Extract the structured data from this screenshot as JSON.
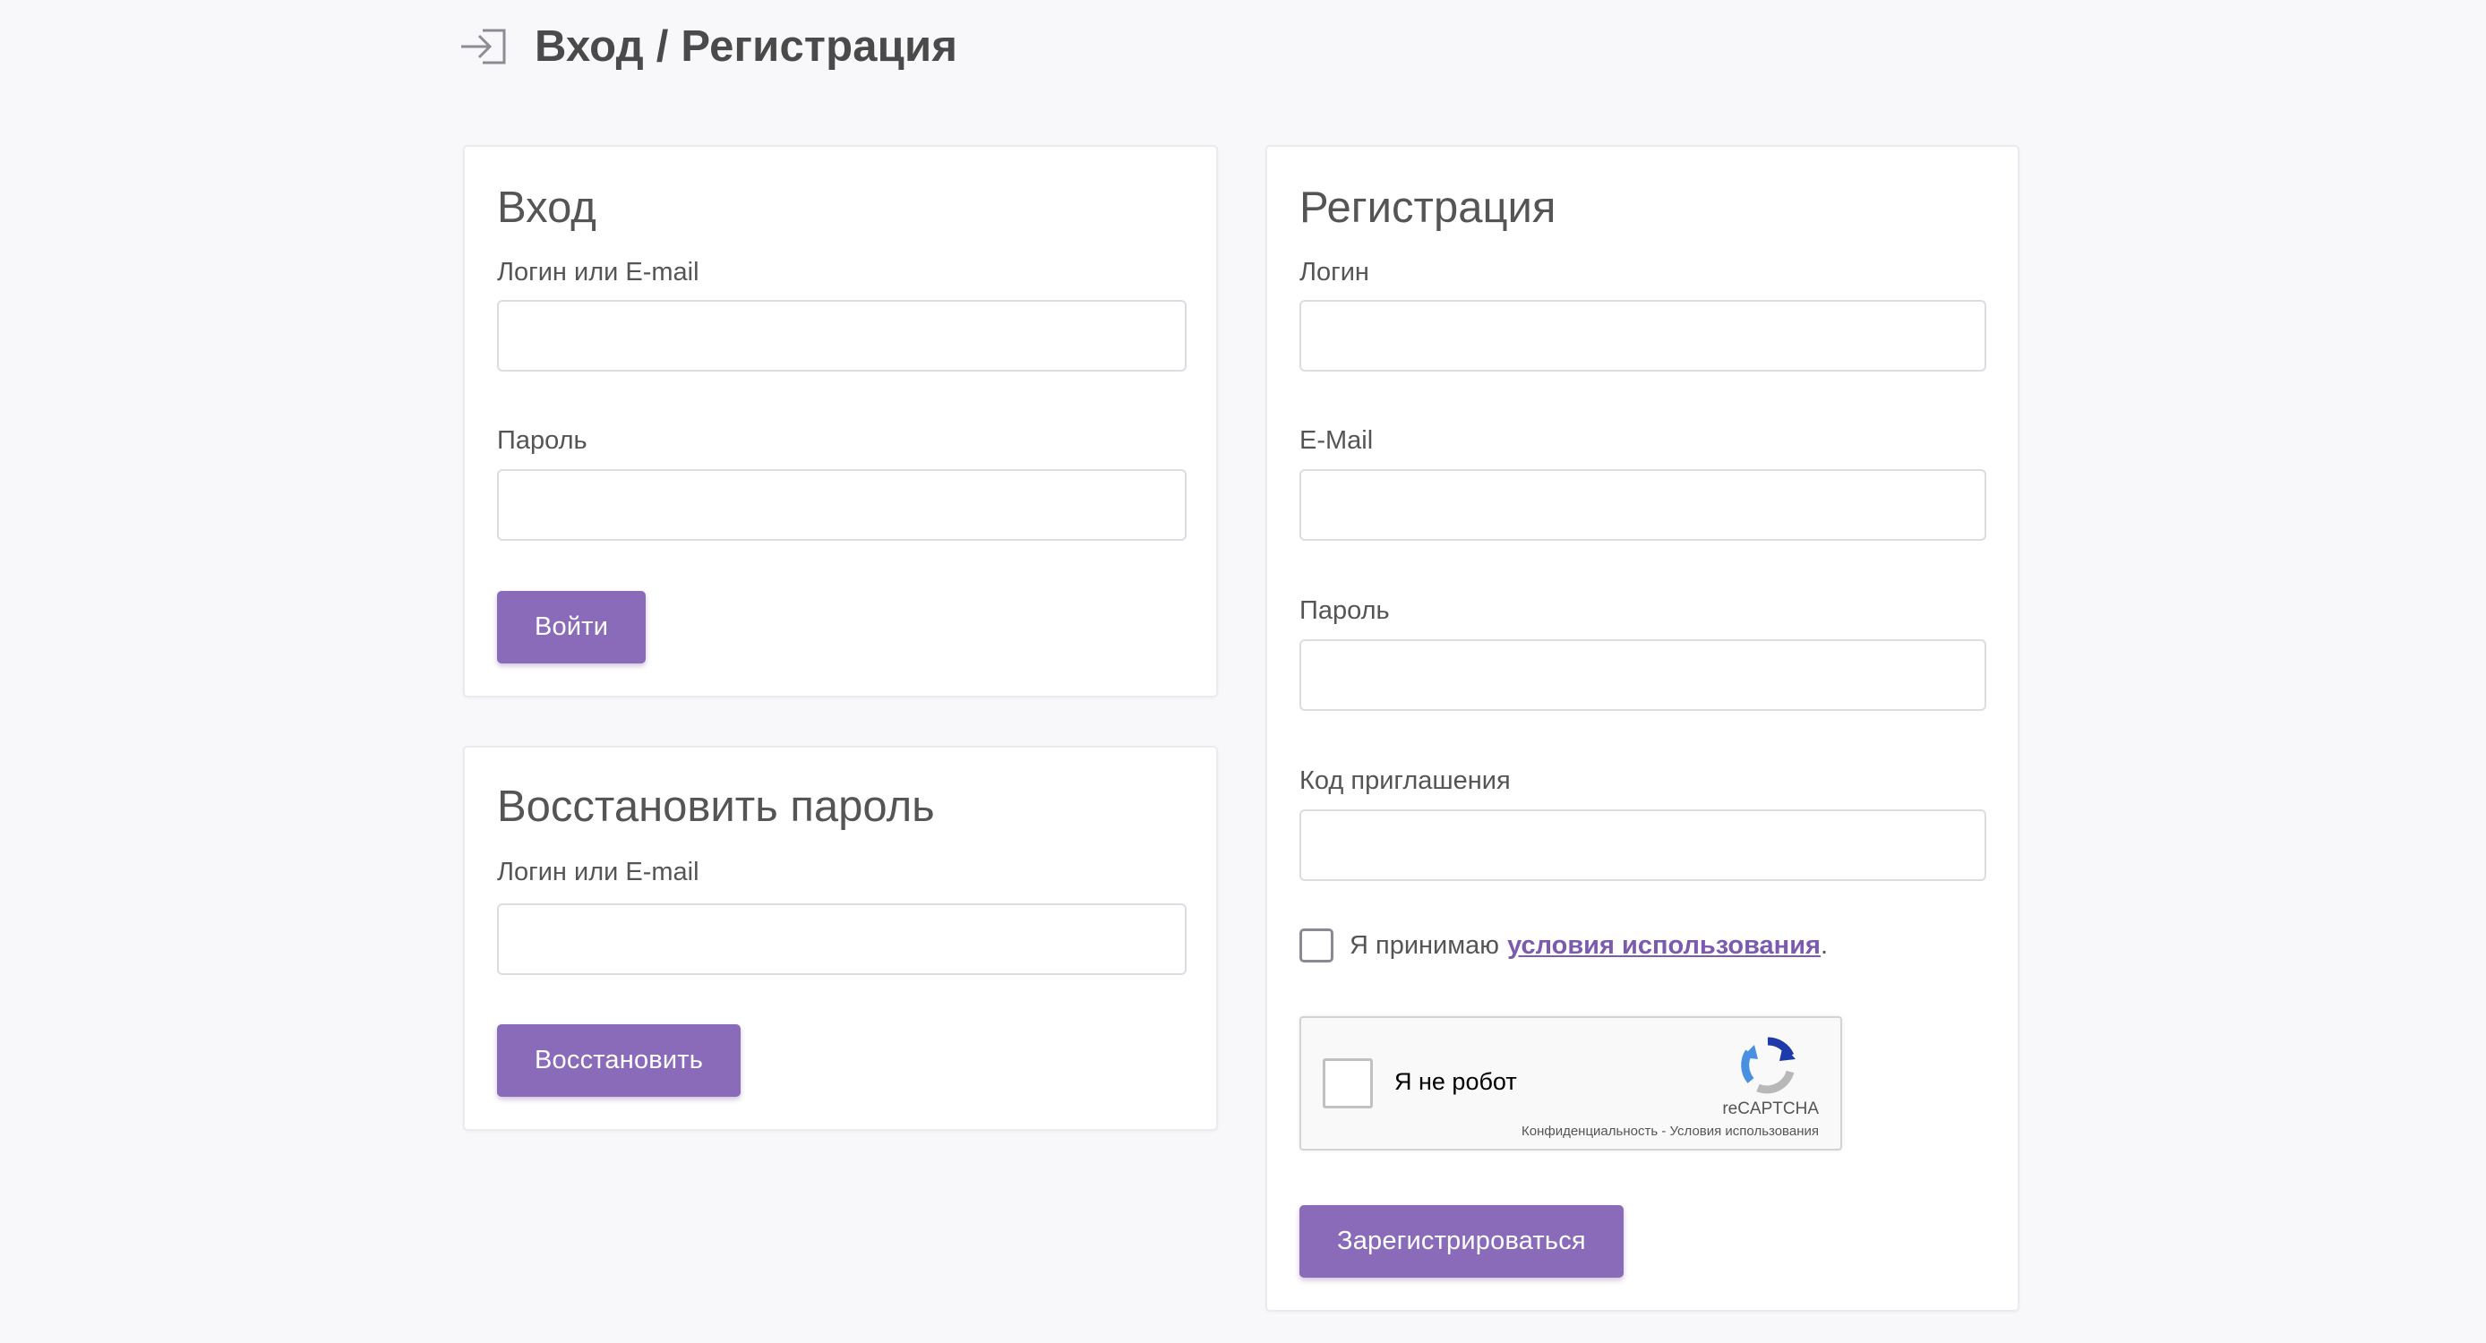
{
  "header": {
    "title": "Вход / Регистрация",
    "icon": "login-arrow-icon"
  },
  "colors": {
    "accent": "#8a6bba",
    "link": "#7b5aaf",
    "background": "#f8f8fa"
  },
  "login": {
    "title": "Вход",
    "username_label": "Логин или E-mail",
    "username_value": "",
    "password_label": "Пароль",
    "password_value": "",
    "submit_label": "Войти"
  },
  "recover": {
    "title": "Восстановить пароль",
    "username_label": "Логин или E-mail",
    "username_value": "",
    "submit_label": "Восстановить"
  },
  "register": {
    "title": "Регистрация",
    "login_label": "Логин",
    "login_value": "",
    "email_label": "E-Mail",
    "email_value": "",
    "password_label": "Пароль",
    "password_value": "",
    "invite_label": "Код приглашения",
    "invite_value": "",
    "terms_prefix": "Я принимаю",
    "terms_link": "условия использования",
    "terms_suffix": ".",
    "terms_checked": false,
    "submit_label": "Зарегистрироваться"
  },
  "recaptcha": {
    "label": "Я не робот",
    "brand": "reCAPTCHA",
    "privacy_link": "Конфиденциальность",
    "separator": " - ",
    "terms_link": "Условия использования",
    "icon": "recaptcha-logo-icon"
  }
}
